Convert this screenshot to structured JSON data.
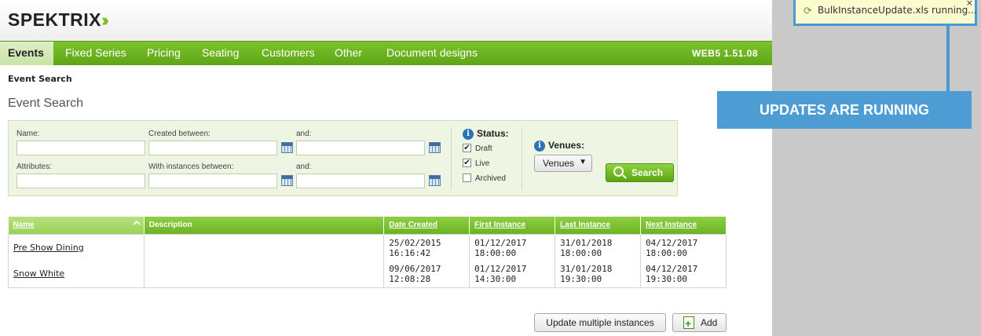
{
  "logo": {
    "text": "SPEKTRIX",
    "mark": "«‹‹"
  },
  "nav": {
    "items": [
      "Events",
      "Fixed Series",
      "Pricing",
      "Seating",
      "Customers",
      "Other",
      "Document designs"
    ],
    "active": "Events",
    "version": "WEB5 1.51.08"
  },
  "breadcrumb": "Event Search",
  "page_title": "Event Search",
  "search": {
    "name_label": "Name:",
    "created_between_label": "Created between:",
    "and_label": "and:",
    "attributes_label": "Attributes:",
    "with_instances_label": "With instances between:",
    "and2_label": "and:",
    "status_title": "Status:",
    "status_options": [
      {
        "label": "Draft",
        "checked": true
      },
      {
        "label": "Live",
        "checked": true
      },
      {
        "label": "Archived",
        "checked": false
      }
    ],
    "venues_title": "Venues:",
    "venues_value": "Venues",
    "search_button": "Search"
  },
  "table": {
    "columns": [
      "Name",
      "Description",
      "Date Created",
      "First Instance",
      "Last Instance",
      "Next Instance"
    ],
    "rows": [
      {
        "name": "Pre Show Dining",
        "description": "",
        "date_created": [
          "25/02/2015",
          "16:16:42"
        ],
        "first_instance": [
          "01/12/2017",
          "18:00:00"
        ],
        "last_instance": [
          "31/01/2018",
          "18:00:00"
        ],
        "next_instance": [
          "04/12/2017",
          "18:00:00"
        ]
      },
      {
        "name": "Snow White",
        "description": "",
        "date_created": [
          "09/06/2017",
          "12:08:28"
        ],
        "first_instance": [
          "01/12/2017",
          "14:30:00"
        ],
        "last_instance": [
          "31/01/2018",
          "19:30:00"
        ],
        "next_instance": [
          "04/12/2017",
          "19:30:00"
        ]
      }
    ]
  },
  "actions": {
    "update_multiple": "Update multiple instances",
    "add": "Add"
  },
  "notification": {
    "text": "BulkInstanceUpdate.xls running...",
    "close": "×"
  },
  "callout": "UPDATES ARE RUNNING",
  "colors": {
    "nav_green": "#6ab424",
    "callout_blue": "#4d9dd4",
    "notif_bg": "#fbfbcf"
  }
}
